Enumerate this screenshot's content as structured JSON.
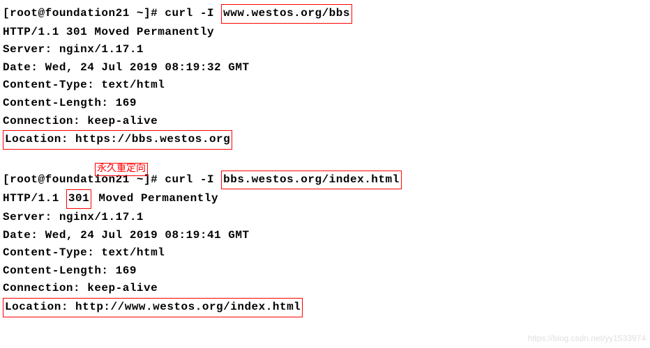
{
  "block1": {
    "prompt_prefix": "[root@foundation21 ~]# curl -I ",
    "prompt_url": "www.westos.org/bbs",
    "status": "HTTP/1.1 301 Moved Permanently",
    "server": "Server: nginx/1.17.1",
    "date": "Date: Wed, 24 Jul 2019 08:19:32 GMT",
    "content_type": "Content-Type: text/html",
    "content_length": "Content-Length: 169",
    "connection": "Connection: keep-alive",
    "location": "Location: https://bbs.westos.org"
  },
  "annotation1": "永久重定向",
  "block2": {
    "prompt_prefix": "[root@foundation21 ~]# curl -I ",
    "prompt_url": "bbs.westos.org/index.html",
    "status_prefix": "HTTP/1.1 ",
    "status_code": "301",
    "status_suffix": " Moved Permanently",
    "server": "Server: nginx/1.17.1",
    "date": "Date: Wed, 24 Jul 2019 08:19:41 GMT",
    "content_type": "Content-Type: text/html",
    "content_length": "Content-Length: 169",
    "connection": "Connection: keep-alive",
    "location": "Location: http://www.westos.org/index.html"
  },
  "watermark": "https://blog.csdn.net/yy1533974"
}
